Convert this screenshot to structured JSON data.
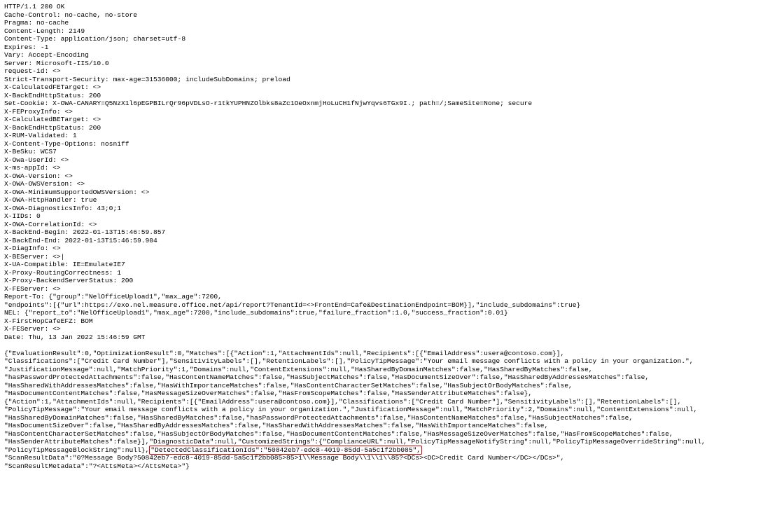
{
  "headers": {
    "status_line": "HTTP/1.1 200 OK",
    "cache_control": "Cache-Control: no-cache, no-store",
    "pragma": "Pragma: no-cache",
    "content_length": "Content-Length: 2149",
    "content_type": "Content-Type: application/json; charset=utf-8",
    "expires": "Expires: -1",
    "vary": "Vary: Accept-Encoding",
    "server": "Server: Microsoft-IIS/10.0",
    "request_id": "request-id: <>",
    "strict_transport": "Strict-Transport-Security: max-age=31536000; includeSubDomains; preload",
    "x_calc_fe_target": "X-CalculatedFETarget: <>",
    "x_backend_http_status_1": "X-BackEndHttpStatus: 200",
    "set_cookie": "Set-Cookie: X-OWA-CANARY=Q5NzX1l6pEGPBILrQr96pVDLsO-r1tkYUPHNZOlbks8aZc1OeOxnmjHoLuCH1fNjwYqvs6TGx9I.; path=/;SameSite=None; secure",
    "x_fe_proxy": "X-FEProxyInfo: <>",
    "x_calc_be_target": "X-CalculatedBETarget: <>",
    "x_backend_http_status_2": "X-BackEndHttpStatus: 200",
    "x_rum": "X-RUM-Validated: 1",
    "x_content_type_opts": "X-Content-Type-Options: nosniff",
    "x_besku": "X-BeSku: WCS7",
    "x_owa_userid": "X-Owa-UserId: <>",
    "x_ms_appid": "x-ms-appId: <>",
    "x_owa_version": "X-OWA-Version: <>",
    "x_owa_owsversion": "X-OWA-OWSVersion: <>",
    "x_owa_min_supported": "X-OWA-MinimumSupportedOWSVersion: <>",
    "x_owa_httphandler": "X-OWA-HttpHandler: true",
    "x_owa_diag": "X-OWA-DiagnosticsInfo: 43;0;1",
    "x_iids": "X-IIDs: 0",
    "x_owa_correlation": "X-OWA-CorrelationId: <>",
    "x_backend_begin": "X-BackEnd-Begin: 2022-01-13T15:46:59.857",
    "x_backend_end": "X-BackEnd-End: 2022-01-13T15:46:59.904",
    "x_diaginfo": "X-DiagInfo: <>",
    "x_beserver": "X-BEServer: <>|",
    "x_ua_compatible": "X-UA-Compatible: IE=EmulateIE7",
    "x_proxy_routing": "X-Proxy-RoutingCorrectness: 1",
    "x_proxy_backend": "X-Proxy-BackendServerStatus: 200",
    "x_feserver_1": "X-FEServer: <>",
    "report_to_line1": "Report-To: {\"group\":\"NelOfficeUpload1\",\"max_age\":7200,",
    "report_to_line2": "\"endpoints\":[{\"url\":https://exo.nel.measure.office.net/api/report?TenantId=<>FrontEnd=Cafe&DestinationEndpoint=BOM}],\"include_subdomains\":true}",
    "nel": "NEL: {\"report_to\":\"NelOfficeUpload1\",\"max_age\":7200,\"include_subdomains\":true,\"failure_fraction\":1.0,\"success_fraction\":0.01}",
    "x_firsthop": "X-FirstHopCafeEFZ: BOM",
    "x_feserver_2": "X-FEServer: <>",
    "date": "Date: Thu, 13 Jan 2022 15:46:59 GMT"
  },
  "body": {
    "part1": "{\"EvaluationResult\":0,\"OptimizationResult\":0,\"Matches\":[{\"Action\":1,\"AttachmentIds\":null,\"Recipients\":[{\"EmailAddress\":usera@contoso.com}],\n\"Classifications\":[\"Credit Card Number\"],\"SensitivityLabels\":[],\"RetentionLabels\":[],\"PolicyTipMessage\":\"Your email message conflicts with a policy in your organization.\",\n\"JustificationMessage\":null,\"MatchPriority\":1,\"Domains\":null,\"ContentExtensions\":null,\"HasSharedByDomainMatches\":false,\"HasSharedByMatches\":false,\n\"hasPasswordProtectedAttachments\":false,\"HasContentNameMatches\":false,\"HasSubjectMatches\":false,\"HasDocumentSizeOver\":false,\"HasSharedByAddressesMatches\":false,\n\"HasSharedWithAddressesMatches\":false,\"HasWithImportanceMatches\":false,\"HasContentCharacterSetMatches\":false,\"HasSubjectOrBodyMatches\":false,\n\"HasDocumentContentMatches\":false,\"HasMessageSizeOverMatches\":false,\"HasFromScopeMatches\":false,\"HasSenderAttributeMatches\":false},\n{\"Action\":1,\"AttachmentIds\":null,\"Recipients\":[{\"EmailAddress\":usera@contoso.com}],\"Classifications\":[\"Credit Card Number\"],\"SensitivityLabels\":[],\"RetentionLabels\":[],\n\"PolicyTipMessage\":\"Your email message conflicts with a policy in your organization.\",\"JustificationMessage\":null,\"MatchPriority\":2,\"Domains\":null,\"ContentExtensions\":null,\n\"HasSharedByDomainMatches\":false,\"HasSharedByMatches\":false,\"hasPasswordProtectedAttachments\":false,\"HasContentNameMatches\":false,\"HasSubjectMatches\":false,\n\"HasDocumentSizeOver\":false,\"HasSharedByAddressesMatches\":false,\"HasSharedWithAddressesMatches\":false,\"HasWithImportanceMatches\":false,\n\"HasContentCharacterSetMatches\":false,\"HasSubjectOrBodyMatches\":false,\"HasDocumentContentMatches\":false,\"HasMessageSizeOverMatches\":false,\"HasFromScopeMatches\":false,\n\"HasSenderAttributeMatches\":false}],\"DiagnosticData\":null,\"CustomizedStrings\":{\"ComplianceURL\":null,\"PolicyTipMessageNotifyString\":null,\"PolicyTipMessageOverrideString\":null,\n\"PolicyTipMessageBlockString\":null},",
    "highlight": "\"DetectedClassificationIds\":\"50842eb7-edc8-4019-85dd-5a5c1f2bb085\",",
    "part2": "\n\"ScanResultData\":\"0?Message Body?50842eb7-edc8-4019-85dd-5a5c1f2bb085>85>1\\\\Message Body\\\\1\\\\1\\\\85?<DCs><DC>Credit Card Number</DC></DCs>\",\n\"ScanResultMetadata\":\"?<AttsMeta></AttsMeta>\"}"
  }
}
